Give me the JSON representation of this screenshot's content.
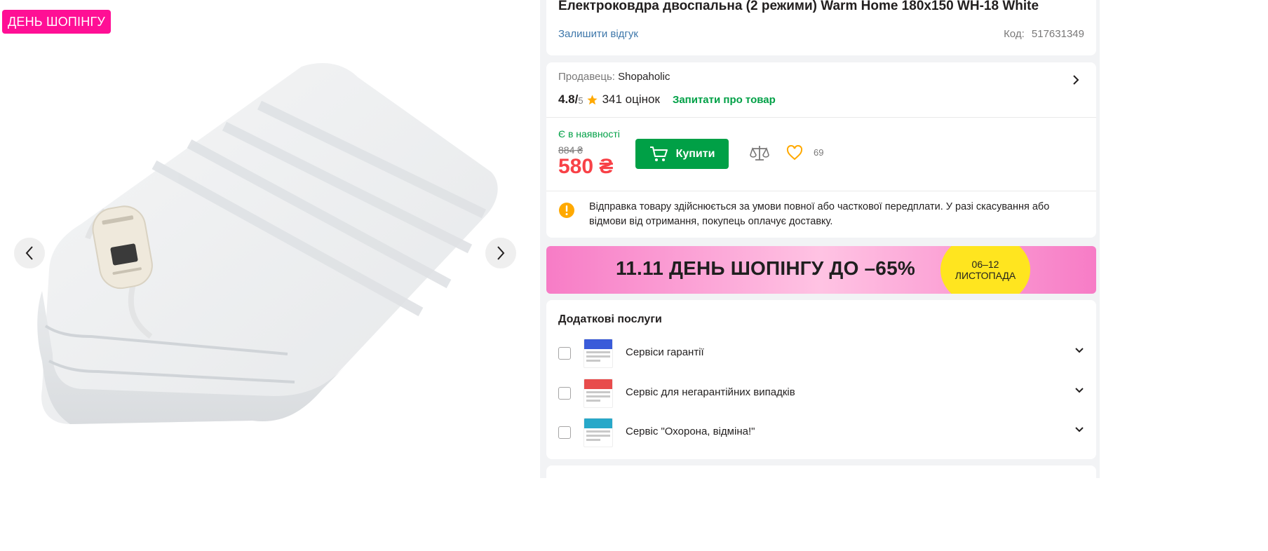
{
  "gallery": {
    "promo_badge": "ДЕНЬ ШОПІНГУ"
  },
  "product": {
    "title": "Електроковдра двоспальна (2 режими) Warm Home 180х150 WH-18 White",
    "review_link": "Залишити відгук",
    "code_label": "Код:",
    "code_value": "517631349"
  },
  "seller": {
    "label": "Продавець:",
    "name": "Shopaholic",
    "rating": "4.8/",
    "rating_max": "5",
    "reviews": "341 оцінок",
    "ask_link": "Запитати про товар"
  },
  "purchase": {
    "stock": "Є в наявності",
    "old_price": "884 ₴",
    "price": "580 ₴",
    "buy_label": "Купити",
    "wishlist_count": "69"
  },
  "notice": {
    "text": "Відправка товару здійснюється за умови повної або часткової передплати. У разі скасування або відмови від отримання, покупець оплачує доставку."
  },
  "banner": {
    "text": "11.11 ДЕНЬ ШОПІНГУ ДО –65%",
    "date_line1": "06–12",
    "date_line2": "ЛИСТОПАДА"
  },
  "services": {
    "title": "Додаткові послуги",
    "items": [
      {
        "label": "Сервіси гарантії",
        "color": "#3a5bd9"
      },
      {
        "label": "Сервіс для негарантійних випадків",
        "color": "#e84c4c"
      },
      {
        "label": "Сервіс \"Охорона, відміна!\"",
        "color": "#27a8c9"
      }
    ]
  },
  "colors": {
    "brand_green": "#00a046",
    "price_red": "#f84147",
    "promo_pink": "#ff0f95",
    "link_blue": "#3e77aa"
  }
}
